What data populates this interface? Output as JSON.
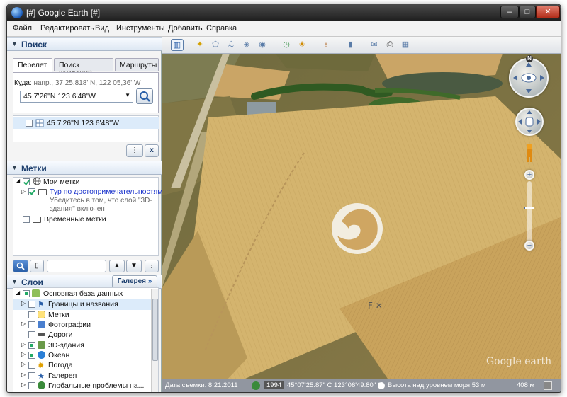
{
  "window": {
    "title": "[#] Google Earth [#]",
    "min": "–",
    "max": "□",
    "close": "✕"
  },
  "menu": [
    "Файл",
    "Редактировать",
    "Вид",
    "Инструменты",
    "Добавить",
    "Справка"
  ],
  "search": {
    "header": "Поиск",
    "tabs": [
      "Перелет",
      "Поиск компаний",
      "Маршруты"
    ],
    "hint_label": "Куда:",
    "hint_example": "напр., 37 25,818' N, 122 05,36' W",
    "input_value": "45 7'26\"N 123 6'48\"W",
    "result": "45 7'26\"N 123 6'48\"W",
    "clear": "x"
  },
  "places": {
    "header": "Метки",
    "my_places": "Мои метки",
    "tour_link": "Тур по достопримечательностям",
    "tour_note_1": "Убедитесь в том, что слой \"3D-",
    "tour_note_2": "здания\" включен",
    "temp": "Временные метки"
  },
  "layers": {
    "header": "Слои",
    "gallery_button": "Галерея",
    "items": [
      {
        "label": "Основная база данных"
      },
      {
        "label": "Границы и названия"
      },
      {
        "label": "Метки"
      },
      {
        "label": "Фотографии"
      },
      {
        "label": "Дороги"
      },
      {
        "label": "3D-здания"
      },
      {
        "label": "Океан"
      },
      {
        "label": "Погода"
      },
      {
        "label": "Галерея"
      },
      {
        "label": "Глобальные проблемы на..."
      }
    ]
  },
  "status": {
    "date": "Дата съемки: 8.21.2011",
    "year": "1994",
    "coords": "45°07'25.87\" С  123°06'49.80\" З",
    "elevation": "Высота над уровнем моря 53 м",
    "eye_alt": "408 м"
  },
  "map": {
    "watermark": "Google earth",
    "north": "N"
  }
}
